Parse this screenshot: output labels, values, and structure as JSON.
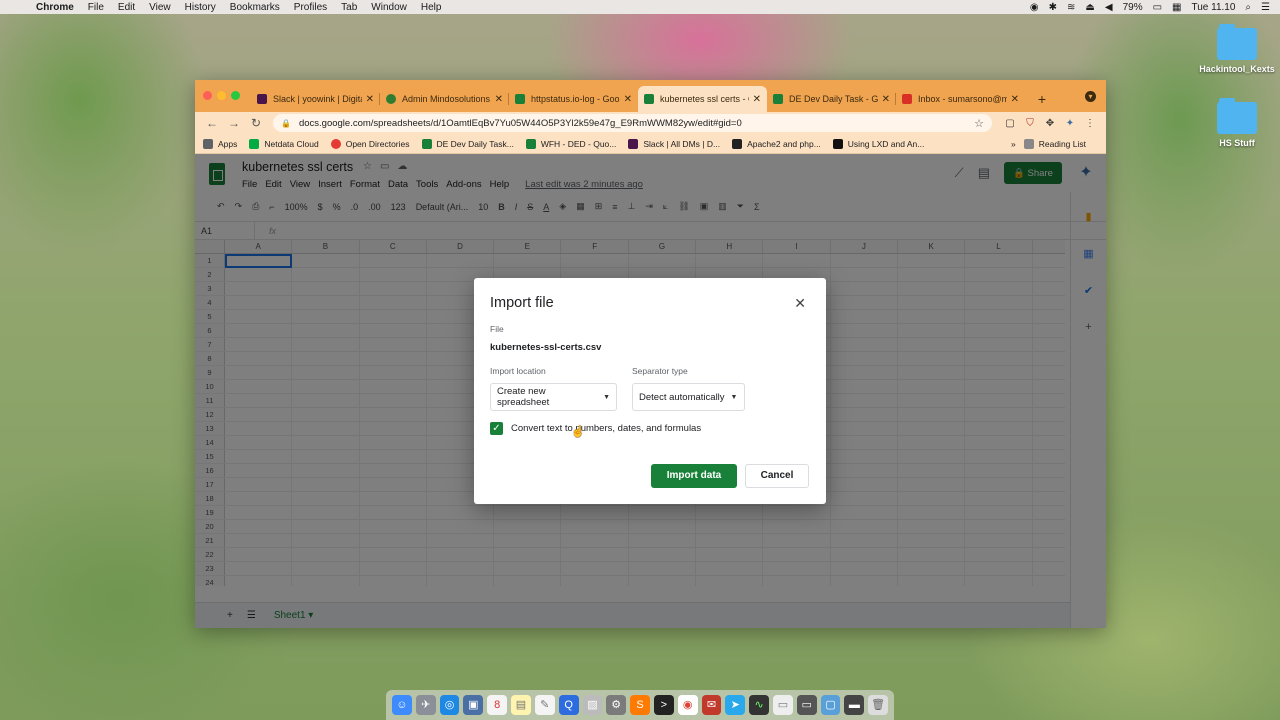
{
  "menubar": {
    "app": "Chrome",
    "items": [
      "File",
      "Edit",
      "View",
      "History",
      "Bookmarks",
      "Profiles",
      "Tab",
      "Window",
      "Help"
    ],
    "battery": "79%",
    "clock": "Tue 11.10"
  },
  "desktop": {
    "icons": [
      {
        "label": "Hackintool_Kexts"
      },
      {
        "label": "HS Stuff"
      }
    ]
  },
  "browser": {
    "tabs": [
      {
        "title": "Slack | yoowink | Digital",
        "color": "#4a154b"
      },
      {
        "title": "Admin Mindosolutions",
        "color": "#2e7d32"
      },
      {
        "title": "httpstatus.io-log - Goo",
        "color": "#188038"
      },
      {
        "title": "kubernetes ssl certs - G",
        "color": "#188038"
      },
      {
        "title": "DE Dev Daily Task - Go",
        "color": "#188038"
      },
      {
        "title": "Inbox - sumarsono@mi",
        "color": "#d93025"
      }
    ],
    "url": "docs.google.com/spreadsheets/d/1OamtlEqBv7Yu05W44O5P3Yl2k59e47g_E9RmWWM82yw/edit#gid=0",
    "bookmarks": [
      {
        "label": "Apps",
        "color": "#5f6368"
      },
      {
        "label": "Netdata Cloud",
        "color": "#00ab44"
      },
      {
        "label": "Open Directories",
        "color": "#e53935"
      },
      {
        "label": "DE Dev Daily Task...",
        "color": "#188038"
      },
      {
        "label": "WFH - DED - Quo...",
        "color": "#188038"
      },
      {
        "label": "Slack | All DMs | D...",
        "color": "#4a154b"
      },
      {
        "label": "Apache2 and php...",
        "color": "#222222"
      },
      {
        "label": "Using LXD and An...",
        "color": "#111111"
      }
    ],
    "reading_list": "Reading List"
  },
  "sheets": {
    "title": "kubernetes ssl certs",
    "menus": [
      "File",
      "Edit",
      "View",
      "Insert",
      "Format",
      "Data",
      "Tools",
      "Add-ons",
      "Help"
    ],
    "last_edit": "Last edit was 2 minutes ago",
    "share": "Share",
    "toolbar": {
      "zoom": "100%",
      "currency": "$",
      "percent": "%",
      "decimal_less": ".0",
      "decimal_more": ".00",
      "number_format": "123",
      "font": "Default (Ari...",
      "font_size": "10"
    },
    "cell_ref": "A1",
    "fx": "fx",
    "columns": [
      "A",
      "B",
      "C",
      "D",
      "E",
      "F",
      "G",
      "H",
      "I",
      "J",
      "K",
      "L"
    ],
    "rows": [
      "1",
      "2",
      "3",
      "4",
      "5",
      "6",
      "7",
      "8",
      "9",
      "10",
      "11",
      "12",
      "13",
      "14",
      "15",
      "16",
      "17",
      "18",
      "19",
      "20",
      "21",
      "22",
      "23",
      "24"
    ],
    "sheet_tab": "Sheet1"
  },
  "dialog": {
    "title": "Import file",
    "file_label": "File",
    "file_name": "kubernetes-ssl-certs.csv",
    "location_label": "Import location",
    "location_value": "Create new spreadsheet",
    "separator_label": "Separator type",
    "separator_value": "Detect automatically",
    "checkbox_label": "Convert text to numbers, dates, and formulas",
    "checkbox_checked": true,
    "import_button": "Import data",
    "cancel_button": "Cancel"
  }
}
